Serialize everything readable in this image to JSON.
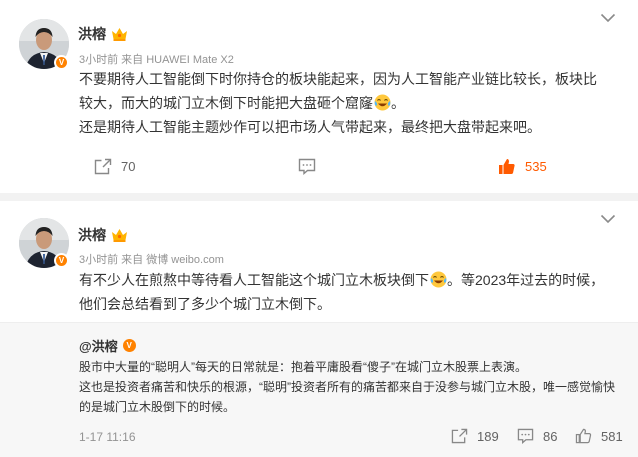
{
  "posts": [
    {
      "author": "洪榕",
      "meta": "3小时前  来自 HUAWEI Mate X2",
      "text_line1": "不要期待人工智能倒下时你持仓的板块能起来，因为人工智能产业链比较长，板块比较大，而大的城门立木倒下时能把大盘砸个窟窿",
      "text_line1_end": "。",
      "text_line2": "还是期待人工智能主题炒作可以把市场人气带起来，最终把大盘带起来吧。",
      "repost_count": "70",
      "like_count": "535",
      "emoji": "laughing-tears-emoji"
    },
    {
      "author": "洪榕",
      "meta": "3小时前  来自 微博 weibo.com",
      "text_part1": "有不少人在煎熬中等待看人工智能这个城门立木板块倒下",
      "text_part2": "。等2023年过去的时候，他们会总结看到了多少个城门立木倒下。",
      "quote": {
        "author": "@洪榕",
        "line1": "股市中大量的“聪明人”每天的日常就是：抱着平庸股看“傻子”在城门立木股票上表演。",
        "line2": "这也是投资者痛苦和快乐的根源，“聪明”投资者所有的痛苦都来自于没参与城门立木股，唯一感觉愉快的是城门立木股倒下的时候。",
        "time": "1-17 11:16",
        "repost_count": "189",
        "comment_count": "86",
        "like_count": "581"
      }
    }
  ],
  "colors": {
    "accent_orange": "#ff8200",
    "like_orange": "#ff5a00",
    "meta_gray": "#939393"
  }
}
